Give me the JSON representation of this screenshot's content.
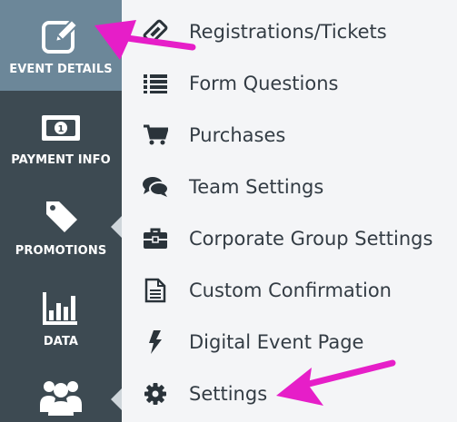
{
  "sidebar": {
    "items": [
      {
        "label": "EVENT DETAILS",
        "icon": "edit-icon",
        "active": true
      },
      {
        "label": "PAYMENT INFO",
        "icon": "money-icon"
      },
      {
        "label": "PROMOTIONS",
        "icon": "tag-icon"
      },
      {
        "label": "DATA",
        "icon": "bar-chart-icon"
      },
      {
        "label": "",
        "icon": "users-icon"
      }
    ]
  },
  "menu": {
    "items": [
      {
        "label": "Registrations/Tickets",
        "icon": "ticket-icon"
      },
      {
        "label": "Form Questions",
        "icon": "list-icon"
      },
      {
        "label": "Purchases",
        "icon": "cart-icon"
      },
      {
        "label": "Team Settings",
        "icon": "chat-icon"
      },
      {
        "label": "Corporate Group Settings",
        "icon": "briefcase-icon"
      },
      {
        "label": "Custom Confirmation",
        "icon": "document-icon"
      },
      {
        "label": "Digital Event Page",
        "icon": "bolt-icon"
      },
      {
        "label": "Settings",
        "icon": "gear-icon"
      }
    ]
  },
  "colors": {
    "sidebar_bg": "#3d4a52",
    "sidebar_active": "#6c8799",
    "menu_bg": "#f4f5f7",
    "menu_text": "#333c44",
    "annotation_arrow": "#e61ec8"
  }
}
